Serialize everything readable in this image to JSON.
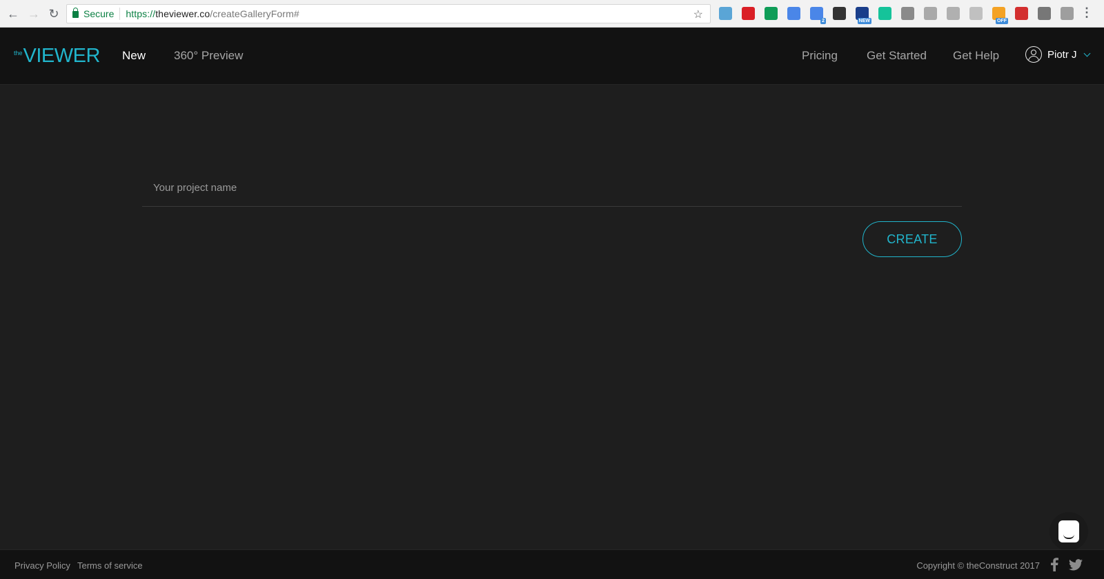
{
  "browser": {
    "secure_label": "Secure",
    "url_scheme": "https://",
    "url_host": "theviewer.co",
    "url_path": "/createGalleryForm#",
    "extensions": [
      {
        "icon": "shield-extension-icon",
        "color": "#5aa5d6"
      },
      {
        "icon": "creative-cloud-icon",
        "color": "#da1f26"
      },
      {
        "icon": "hangouts-bubble-icon",
        "color": "#0f9d58"
      },
      {
        "icon": "shortcut-extension-icon",
        "color": "#4a86e8"
      },
      {
        "icon": "code-extension-icon",
        "color": "#4a86e8",
        "badge": "2"
      },
      {
        "icon": "lightbulb-extension-icon",
        "color": "#333333"
      },
      {
        "icon": "news-extension-icon",
        "color": "#1a3e8a",
        "badge": "NEW"
      },
      {
        "icon": "grammarly-icon",
        "color": "#15c39a"
      },
      {
        "icon": "camera-extension-icon",
        "color": "#8a8a8a"
      },
      {
        "icon": "drive-extension-icon",
        "color": "#a9a9a9"
      },
      {
        "icon": "pocket-extension-icon",
        "color": "#b0b0b0"
      },
      {
        "icon": "reader-extension-icon",
        "color": "#c0c0c0"
      },
      {
        "icon": "image-extension-icon",
        "color": "#f4a224",
        "badge": "OFF"
      },
      {
        "icon": "puzzle-extension-icon",
        "color": "#d32f2f"
      },
      {
        "icon": "tabs-extension-icon",
        "color": "#777777"
      },
      {
        "icon": "wikipedia-extension-icon",
        "color": "#9e9e9e"
      }
    ]
  },
  "header": {
    "logo_small": "the",
    "logo_main": "VIEWER",
    "nav": {
      "new": "New",
      "preview": "360° Preview",
      "pricing": "Pricing",
      "get_started": "Get Started",
      "get_help": "Get Help"
    },
    "user_name": "Piotr J",
    "accent_color": "#21b5cc"
  },
  "form": {
    "project_placeholder": "Your project name",
    "project_value": "",
    "create_label": "CREATE"
  },
  "footer": {
    "privacy": "Privacy Policy",
    "terms": "Terms of service",
    "copyright": "Copyright © theConstruct 2017"
  }
}
